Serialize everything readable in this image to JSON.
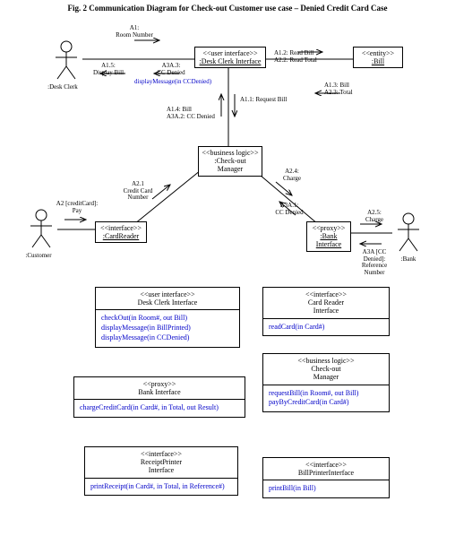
{
  "title": "Fig. 2 Communication Diagram for Check-out Customer use case – Denied Credit Card Case",
  "nodes": {
    "deskClerkInterface": {
      "stereo": "<<user interface>>",
      "name": ":Desk Clerk Interface"
    },
    "bill": {
      "stereo": "<<entity>>",
      "name": ":Bill"
    },
    "checkoutManager": {
      "stereo": "<<business logic>>",
      "name": ":Check-out Manager"
    },
    "cardReader": {
      "stereo": "<<interface>>",
      "name": ":CardReader"
    },
    "bankInterface": {
      "stereo": "<<proxy>>",
      "name": ":Bank Interface"
    }
  },
  "actors": {
    "deskClerk": ":Desk Clerk",
    "customer": ":Customer",
    "bank": ":Bank"
  },
  "labels": {
    "a1": "A1:\nRoom Number",
    "a15": "A1.5:\nDisplay Bill",
    "a3a3": "A3A.3:\nCC Denied",
    "displayMsg": "displayMessage(in CCDenied)",
    "a11": "A1.1: Request Bill",
    "a14": "A1.4: Bill\nA3A.2: CC Denied",
    "a12": "A1.2: Read Bill\nA2.2: Read Total",
    "a13": "A1.3: Bill\nA2.3: Total",
    "a21": "A2.1\nCredit Card\nNumber",
    "a2pay": "A2 [creditCard]:\nPay",
    "a24": "A2.4:\nCharge",
    "a3a1": "A3A.1:\nCC Denied",
    "a25": "A2.5:\nCharge",
    "a3aRef": "A3A [CC\nDenied]:\nReference\nNumber"
  },
  "classes": {
    "dci": {
      "stereo": "<<user interface>>",
      "name": "Desk Clerk Interface",
      "ops": [
        "checkOut(in Room#, out Bill)",
        "displayMessage(in BillPrinted)",
        "displayMessage(in CCDenied)"
      ]
    },
    "cri": {
      "stereo": "<<interface>>",
      "name": "Card Reader Interface",
      "ops": [
        "readCard(in Card#)"
      ]
    },
    "com": {
      "stereo": "<<business logic>>",
      "name": "Check-out Manager",
      "ops": [
        "requestBill(in Room#, out Bill)",
        "payByCreditCard(in Card#)"
      ]
    },
    "bi": {
      "stereo": "<<proxy>>",
      "name": "Bank Interface",
      "ops": [
        "chargeCreditCard(in Card#, in Total, out Result)"
      ]
    },
    "rpi": {
      "stereo": "<<interface>>",
      "name": "ReceiptPrinter Interface",
      "ops": [
        "printReceipt(in Card#, in Total, in Reference#)"
      ]
    },
    "bpi": {
      "stereo": "<<interface>>",
      "name": "BillPrinterInterface",
      "ops": [
        "printBill(in Bill)"
      ]
    }
  }
}
